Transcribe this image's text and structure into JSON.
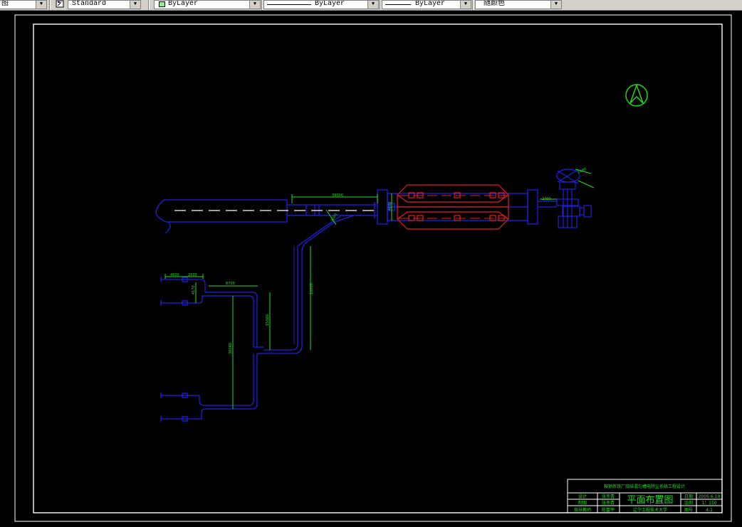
{
  "toolbar": {
    "layer_partial": "图",
    "text_style": "Standard",
    "color": "ByLayer",
    "linetype": "ByLayer",
    "lineweight": "ByLayer",
    "plot_style": "随颜色",
    "color_swatch": "#90ee90"
  },
  "drawing": {
    "dimensions": {
      "d1": "39000",
      "d2": "2400",
      "d3": "4100",
      "d4": "3000",
      "d5": "10000",
      "d6": "4600",
      "d7": "2000",
      "d8": "4170",
      "d9": "8700",
      "d10": "30040",
      "d11": "15000",
      "d12": "1690"
    },
    "title_block": {
      "project": "鞍钢炼铁厂烧结混匀槽电除尘系统工程设计",
      "drawing_title": "平面布置图",
      "r1_label": "设计",
      "r1_name": "张冬青",
      "r2_label": "制图",
      "r2_name": "张冬青",
      "r3_label": "指导教师",
      "r3_name": "陈富平",
      "school": "辽宁工程技术大学",
      "date_label": "日期",
      "date_value": "2005.6.10",
      "scale_label": "比例",
      "scale_value": "1：150",
      "sheet_label": "图号",
      "sheet_value": "4-1"
    },
    "colors": {
      "border": "#ffffff",
      "duct": "#2020e0",
      "precipitator": "#e02020",
      "dimension": "#20e020",
      "north_arrow": "#20e020"
    }
  }
}
